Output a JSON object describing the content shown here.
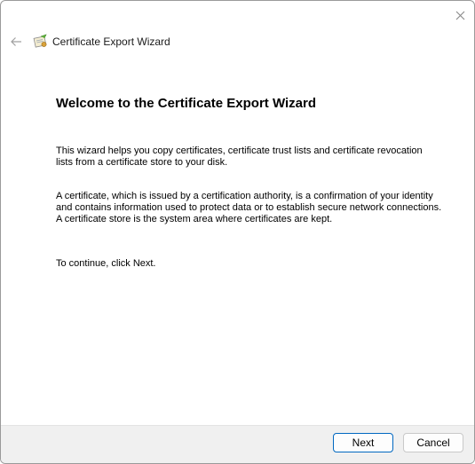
{
  "window": {
    "title": "Certificate Export Wizard"
  },
  "icons": {
    "close": "close-icon",
    "back": "back-arrow-icon",
    "wizard": "certificate-icon"
  },
  "content": {
    "heading": "Welcome to the Certificate Export Wizard",
    "paragraph1": "This wizard helps you copy certificates, certificate trust lists and certificate revocation lists from a certificate store to your disk.",
    "paragraph2": "A certificate, which is issued by a certification authority, is a confirmation of your identity and contains information used to protect data or to establish secure network connections. A certificate store is the system area where certificates are kept.",
    "paragraph3": "To continue, click Next."
  },
  "buttons": {
    "next": "Next",
    "cancel": "Cancel"
  },
  "colors": {
    "accent": "#0067c0",
    "footer_bg": "#f0f0f0"
  }
}
